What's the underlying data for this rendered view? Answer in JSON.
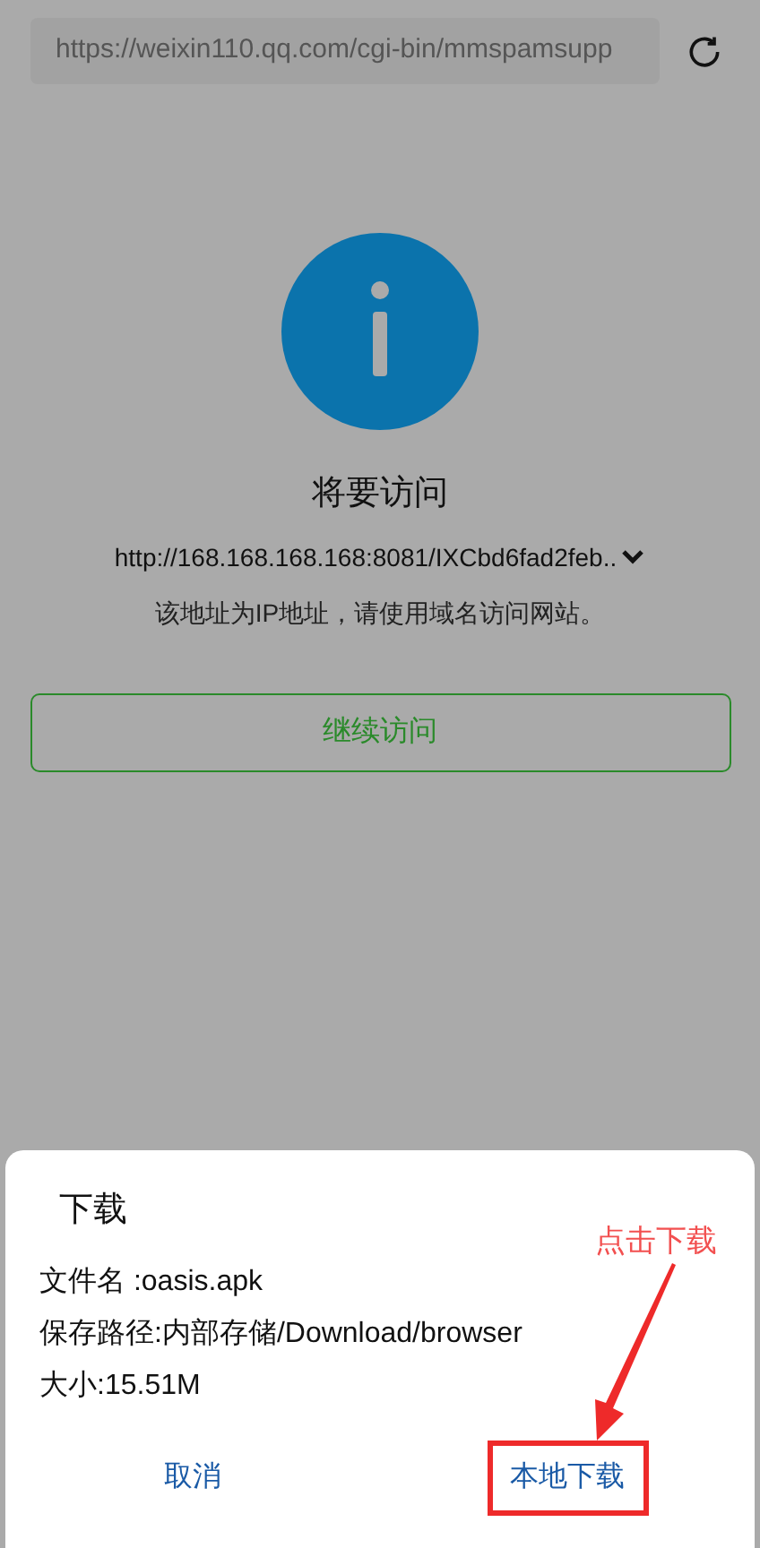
{
  "address_bar": {
    "url": "https://weixin110.qq.com/cgi-bin/mmspamsupp"
  },
  "notice": {
    "title": "将要访问",
    "url": "http://168.168.168.168:8081/IXCbd6fad2feb..",
    "message": "该地址为IP地址，请使用域名访问网站。",
    "button": "继续访问"
  },
  "dialog": {
    "title": "下载",
    "details": [
      "文件名 :oasis.apk",
      "保存路径:内部存储/Download/browser",
      "大小:15.51M"
    ],
    "buttons": [
      {
        "label": "取消",
        "highlighted": false
      },
      {
        "label": "本地下载",
        "highlighted": true
      }
    ]
  },
  "annotation": {
    "text": "点击下载"
  }
}
